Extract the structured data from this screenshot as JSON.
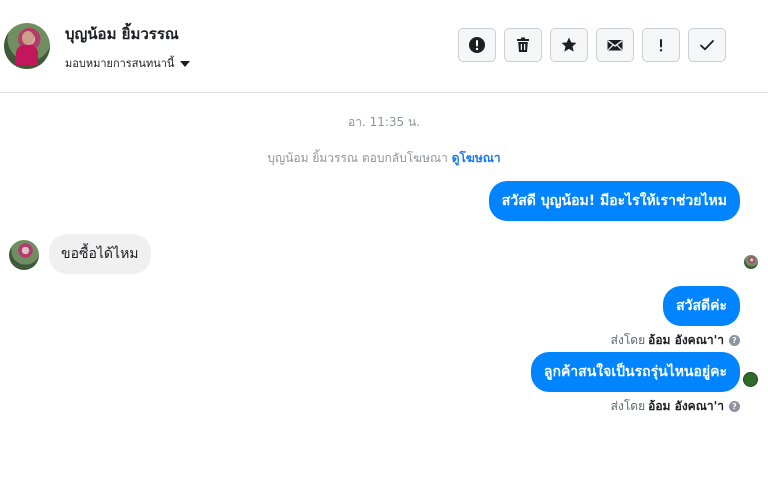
{
  "header": {
    "contact_name": "บุญน้อม ยิ้มวรรณ",
    "assign_label": "มอบหมายการสนทนานี้",
    "actions": [
      {
        "icon": "alert-icon"
      },
      {
        "icon": "trash-icon"
      },
      {
        "icon": "star-icon"
      },
      {
        "icon": "mail-icon"
      },
      {
        "icon": "exclamation-icon"
      },
      {
        "icon": "check-icon"
      }
    ]
  },
  "conversation": {
    "timestamp": "อา. 11:35 น.",
    "system_message": {
      "text": "บุญน้อม ยิ้มวรรณ ตอบกลับโฆษณา",
      "link": "ดูโฆษณา"
    },
    "messages": [
      {
        "direction": "out",
        "text": "สวัสดี บุญน้อม! มีอะไรให้เราช่วยไหม"
      },
      {
        "direction": "in",
        "text": "ขอซื้อได้ไหม"
      },
      {
        "direction": "out",
        "text": "สวัสดีค่ะ",
        "sent_by_prefix": "ส่งโดย",
        "sent_by_name": "อ้อม อังคณา'า"
      },
      {
        "direction": "out",
        "text": "ลูกค้าสนใจเป็นรถรุ่นไหนอยู่คะ",
        "sent_by_prefix": "ส่งโดย",
        "sent_by_name": "อ้อม อังคณา'า"
      }
    ]
  },
  "colors": {
    "outgoing_bubble": "#0084ff",
    "incoming_bubble": "#f1f0f0",
    "link": "#1877f2"
  }
}
